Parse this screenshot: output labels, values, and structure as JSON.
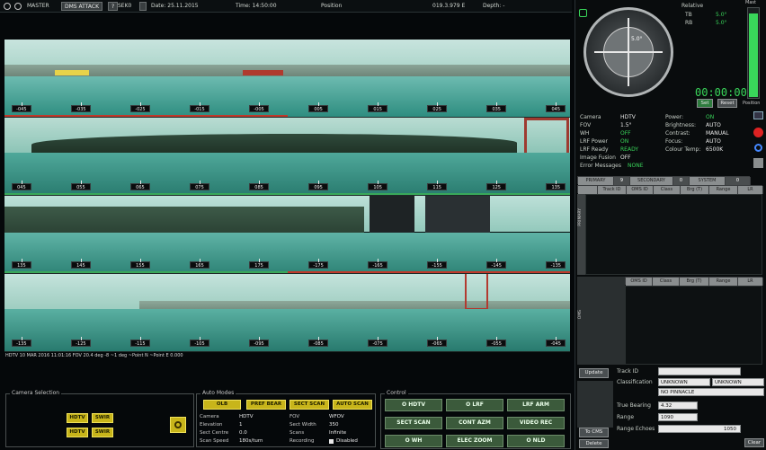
{
  "topbar": {
    "mode": "MASTER",
    "attack_mode": "DMS ATTACK",
    "help_icon": "?",
    "sensor": "SEK0",
    "date": "Date: 25.11.2015",
    "time": "Time: 14:50:00",
    "position_label": "Position",
    "position_value": "019.3.979 E",
    "depth_label": "Depth: -"
  },
  "strips": [
    {
      "ticks": [
        "-045",
        "-035",
        "-025",
        "-015",
        "-005",
        "005",
        "015",
        "025",
        "035",
        "045"
      ]
    },
    {
      "ticks": [
        "045",
        "055",
        "065",
        "075",
        "085",
        "095",
        "105",
        "115",
        "125",
        "135"
      ]
    },
    {
      "ticks": [
        "135",
        "145",
        "155",
        "165",
        "175",
        "-175",
        "-165",
        "-155",
        "-145",
        "-135"
      ]
    },
    {
      "ticks": [
        "-135",
        "-125",
        "-115",
        "-105",
        "-095",
        "-085",
        "-075",
        "-065",
        "-055",
        "-045"
      ]
    }
  ],
  "status_line": "HDTV 10 MAR 2016 11:01:16 FOV 20.4 deg -8 ~1 deg ~Point N ~Point E 0.000",
  "compass": {
    "mode": "Relative",
    "tb_label": "TB",
    "tb_value": "5.0°",
    "rb_label": "RB",
    "rb_value": "5.0°",
    "center_value": "5.0°",
    "timer": "00:00:00",
    "set_btn": "Set",
    "reset_btn": "Reset"
  },
  "mast": {
    "label_top": "Mast",
    "label_bottom": "Position",
    "level": 0.95
  },
  "camera_info": {
    "rows_left": [
      {
        "k": "Camera",
        "v": "HDTV"
      },
      {
        "k": "FOV",
        "v": "1.5°"
      },
      {
        "k": "WH",
        "v": "OFF"
      },
      {
        "k": "LRF Power",
        "v": "ON"
      },
      {
        "k": "LRF Ready",
        "v": "READY"
      },
      {
        "k": "Image Fusion",
        "v": "OFF"
      },
      {
        "k": "Error Messages",
        "v": "NONE"
      }
    ],
    "rows_right": [
      {
        "k": "Power:",
        "v": "ON"
      },
      {
        "k": "Brightness:",
        "v": "AUTO"
      },
      {
        "k": "Contrast:",
        "v": "MANUAL"
      },
      {
        "k": "Focus:",
        "v": "AUTO"
      },
      {
        "k": "Colour Temp:",
        "v": "6500K"
      }
    ]
  },
  "track_table": {
    "primary_label": "PRIMARY",
    "primary_count": "9",
    "secondary_label": "SECONDARY",
    "secondary_count": "0",
    "system_label": "SYSTEM",
    "system_count": "0",
    "columns": [
      "",
      "Track ID",
      "OMS ID",
      "Class",
      "Brg (T)",
      "Range",
      "LR"
    ],
    "side_label": "PRIMARY",
    "columns2": [
      "",
      "OMS ID",
      "Class",
      "Brg (T)",
      "Range",
      "LR"
    ],
    "side_label2": "OMS"
  },
  "track_detail": {
    "update_btn": "Update",
    "to_cms_btn": "To CMS",
    "delete_btn": "Delete",
    "track_id_label": "Track ID",
    "classification_label": "Classification",
    "class_value_1": "UNKNOWN",
    "class_value_2": "UNKNOWN",
    "pinnacle_value": "NO PINNACLE",
    "true_bearing_label": "True Bearing",
    "true_bearing_value": "4.32",
    "range_label": "Range",
    "range_value": "1090",
    "range_echoes_label": "Range Echoes",
    "range_echoes_value": "1050",
    "clear_btn": "Clear"
  },
  "camera_selection": {
    "title": "Camera Selection",
    "buttons": [
      "HDTV",
      "SWIR",
      "HDTV",
      "SWIR"
    ]
  },
  "auto_modes": {
    "title": "Auto Modes",
    "buttons": [
      "OLB",
      "PREF BEAR",
      "SECT SCAN",
      "AUTO SCAN"
    ],
    "left": [
      {
        "k": "Camera",
        "v": "HDTV"
      },
      {
        "k": "Elevation",
        "v": "1"
      },
      {
        "k": "Sect Centre",
        "v": "0.0"
      },
      {
        "k": "Scan Speed",
        "v": "180s/turn"
      }
    ],
    "right": [
      {
        "k": "FOV",
        "v": "WFOV"
      },
      {
        "k": "Sect Width",
        "v": "350"
      },
      {
        "k": "Scans",
        "v": "Infinite"
      },
      {
        "k": "Recording",
        "v": "Disabled"
      }
    ]
  },
  "control": {
    "title": "Control",
    "buttons": [
      "O HDTV",
      "O LRF",
      "LRF ARM",
      "SECT SCAN",
      "CONT AZM",
      "VIDEO REC",
      "O WH",
      "ELEC ZOOM",
      "O NLD"
    ]
  },
  "colors": {
    "accent_green": "#39d65a",
    "button_yellow": "#c8b51a",
    "sea_teal": "#3f9f90",
    "track_red": "#c0392b"
  }
}
